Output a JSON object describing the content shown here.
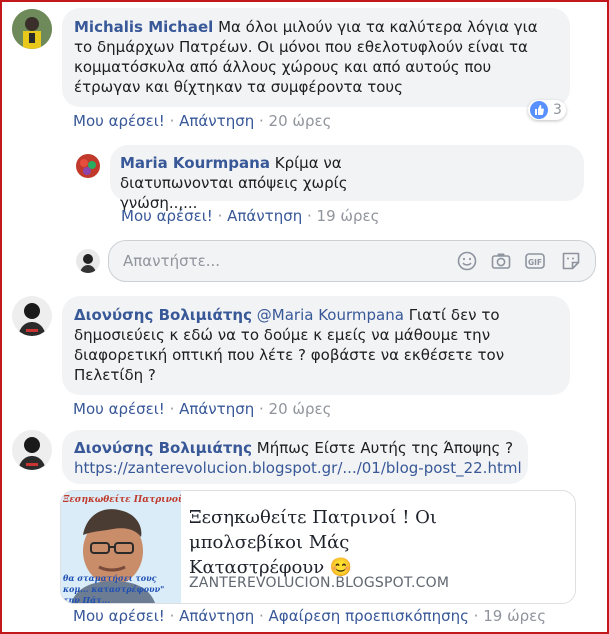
{
  "comments": [
    {
      "author": "Michalis Michael",
      "text": "Μα όλοι μιλούν για τα καλύτερα λόγια για το δημάρχων Πατρέων. Οι μόνοι που εθελοτυφλούν είναι τα κομματόσκυλα από άλλους χώρους και από αυτούς που έτρωγαν και θίχτηκαν τα συμφέροντα τους",
      "like_label": "Μου αρέσει!",
      "reply_label": "Απάντηση",
      "time": "20 ώρες",
      "reaction_count": "3",
      "reaction_icon": "like-icon"
    },
    {
      "author": "Maria Kourmpana",
      "text": "Κρίμα να διατυπωνονται απόψεις χωρίς γνώση..,...",
      "like_label": "Μου αρέσει!",
      "reply_label": "Απάντηση",
      "time": "19 ώρες"
    },
    {
      "author": "Διονύσης Βολιμιάτης",
      "mention": "@Maria Kourmpana",
      "text": "Γιατί δεν το δημοσιεύεις κ εδώ να το δούμε κ εμείς να μάθουμε την διαφορετική οπτική που λέτε ? φοβάστε να εκθέσετε τον Πελετίδη ?",
      "like_label": "Μου αρέσει!",
      "reply_label": "Απάντηση",
      "time": "20 ώρες"
    },
    {
      "author": "Διονύσης Βολιμιάτης",
      "text": "Μήπως Είστε Αυτής της Άποψης ?",
      "url": "https://zanterevolucion.blogspot.gr/.../01/blog-post_22.html",
      "like_label": "Μου αρέσει!",
      "reply_label": "Απάντηση",
      "remove_preview_label": "Αφαίρεση προεπισκόπησης",
      "time": "19 ώρες"
    }
  ],
  "reply_box": {
    "placeholder": "Απαντήστε..."
  },
  "link_card": {
    "title": "Ξεσηκωθείτε Πατρινοί ! Οι μπολσεβίκοι Μάς Καταστρέφουν 😊",
    "domain": "ZANTEREVOLUCION.BLOGSPOT.COM",
    "thumb_top_text": "Ξεσηκωθείτε Πατρινοί !",
    "thumb_bottom_text": "θα σταματήσει τους κομ... καταστρέφουν\" την Πάτ..."
  },
  "colors": {
    "link": "#385898",
    "bubble": "#f2f3f5",
    "meta": "#90949c",
    "frame": "#c2181b",
    "like": "#5890ff"
  }
}
